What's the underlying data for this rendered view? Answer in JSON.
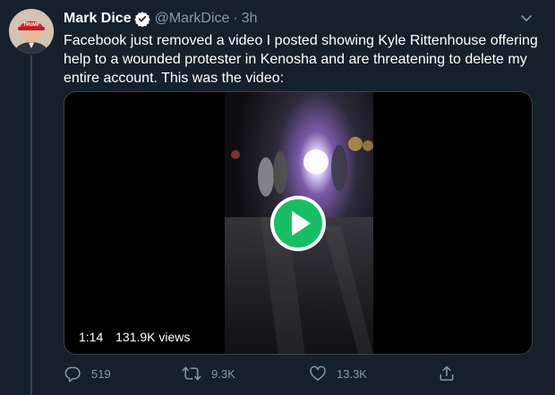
{
  "tweet": {
    "author": {
      "name": "Mark Dice",
      "handle": "@MarkDice",
      "verified": true,
      "avatar_hat_text": "TRUMP"
    },
    "separator": "·",
    "time": "3h",
    "text_lines": [
      "Facebook just removed a video I posted showing Kyle Rittenhouse offering",
      "help to a wounded protester in Kenosha and are threatening to delete my",
      "entire account.  This was the video:"
    ],
    "video": {
      "duration": "1:14",
      "views": "131.9K views",
      "play_icon_color": "#17bf63"
    },
    "actions": {
      "reply_count": "519",
      "retweet_count": "9.3K",
      "like_count": "13.3K"
    },
    "icons": [
      "verified-badge-icon",
      "chevron-down-icon",
      "play-icon",
      "reply-icon",
      "retweet-icon",
      "like-icon",
      "share-icon"
    ],
    "colors": {
      "background": "#15202b",
      "secondary_text": "#8899a6",
      "border": "#38444d"
    }
  }
}
